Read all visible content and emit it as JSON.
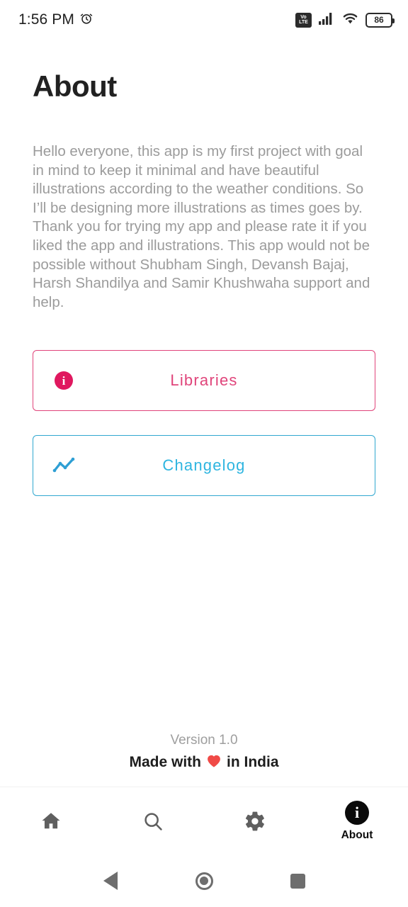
{
  "status_bar": {
    "time": "1:56 PM",
    "alarm_icon": "alarm-clock-icon",
    "volte_top": "Vo",
    "volte_bottom": "LTE",
    "signal_icon": "cellular-signal-icon",
    "wifi_icon": "wifi-icon",
    "battery_level": "86"
  },
  "page": {
    "title": "About",
    "paragraph": "Hello everyone, this app is my first project with goal in mind to keep it minimal and have beautiful illustrations according to the weather conditions. So I’ll be designing more illustrations as times goes by. Thank you for trying my app and please rate it if you liked the app and illustrations. This app would not be possible without Shubham Singh, Devansh Bajaj, Harsh Shandilya and Samir Khushwaha support and help."
  },
  "buttons": {
    "libraries": {
      "label": "Libraries",
      "icon": "info-circle-icon",
      "color": "#e0457b",
      "icon_fill": "#e0185f"
    },
    "changelog": {
      "label": "Changelog",
      "icon": "trending-line-chart-icon",
      "color": "#2eb5e0",
      "border_color": "#31a8d0"
    }
  },
  "footer": {
    "version": "Version 1.0",
    "made_with_prefix": "Made with",
    "heart": "❤️",
    "made_with_suffix": "in India"
  },
  "bottom_nav": {
    "items": [
      {
        "name": "home",
        "icon": "home-icon",
        "label": "",
        "active": false
      },
      {
        "name": "search",
        "icon": "search-icon",
        "label": "",
        "active": false
      },
      {
        "name": "settings",
        "icon": "gear-icon",
        "label": "",
        "active": false
      },
      {
        "name": "about",
        "icon": "info-circle-icon",
        "label": "About",
        "active": true
      }
    ],
    "active_label": "About",
    "active_color": "#0a0a0a",
    "inactive_color": "#5f5f5f"
  },
  "system_nav": {
    "back": "back-triangle-icon",
    "home": "home-circle-icon",
    "recents": "recents-square-icon",
    "color": "#6e6e6e"
  }
}
